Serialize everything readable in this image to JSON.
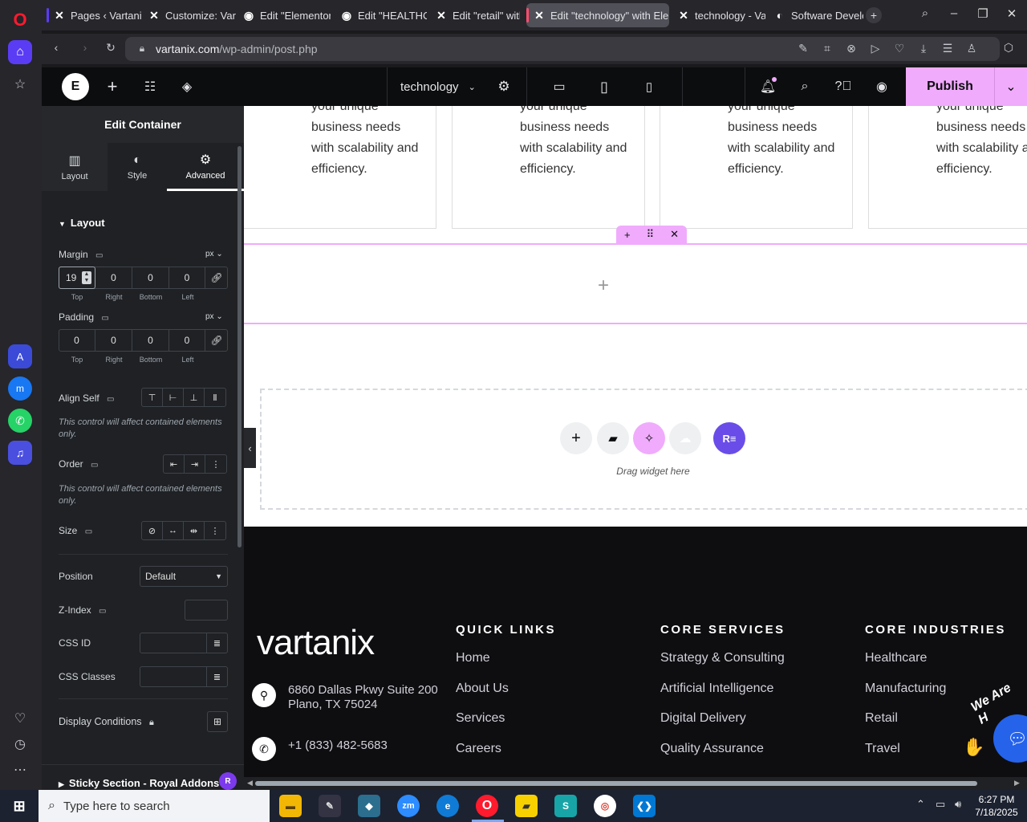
{
  "browser": {
    "tabs": [
      {
        "label": "Pages ‹ Vartanix",
        "icon": "elementor-x"
      },
      {
        "label": "Customize: Vartanix",
        "icon": "elementor-x"
      },
      {
        "label": "Edit \"Elementor",
        "icon": "globe"
      },
      {
        "label": "Edit \"HEALTHCARE",
        "icon": "globe"
      },
      {
        "label": "Edit \"retail\" with",
        "icon": "elementor-x"
      },
      {
        "label": "Edit \"technology\" with Elementor",
        "icon": "elementor-x"
      },
      {
        "label": "technology - Vartanix",
        "icon": "elementor-x"
      },
      {
        "label": "Software Development",
        "icon": "chrome-like"
      }
    ],
    "url_domain": "vartanix.com",
    "url_path": "/wp-admin/post.php"
  },
  "elementor_topbar": {
    "page_name": "technology",
    "publish_label": "Publish"
  },
  "panel": {
    "title": "Edit Container",
    "tabs": [
      {
        "label": "Layout",
        "icon": "layout-icon"
      },
      {
        "label": "Style",
        "icon": "style-icon"
      },
      {
        "label": "Advanced",
        "icon": "gear-icon"
      }
    ],
    "section_layout": "Layout",
    "margin": {
      "label": "Margin",
      "unit": "px",
      "top": "19",
      "right": "0",
      "bottom": "0",
      "left": "0"
    },
    "padding": {
      "label": "Padding",
      "unit": "px",
      "top": "0",
      "right": "0",
      "bottom": "0",
      "left": "0"
    },
    "dim_labels": {
      "top": "Top",
      "right": "Right",
      "bottom": "Bottom",
      "left": "Left"
    },
    "align_self": {
      "label": "Align Self",
      "note": "This control will affect contained elements only."
    },
    "order": {
      "label": "Order",
      "note": "This control will affect contained elements only."
    },
    "size_label": "Size",
    "position": {
      "label": "Position",
      "value": "Default"
    },
    "zindex_label": "Z-Index",
    "css_id_label": "CSS ID",
    "css_classes_label": "CSS Classes",
    "display_conditions_label": "Display Conditions",
    "sticky_section_label": "Sticky Section - Royal Addons",
    "badge": "R"
  },
  "canvas": {
    "card_text": [
      "your unique",
      "business needs",
      "with scalability and",
      "efficiency."
    ],
    "card_text_last": [
      "your unique",
      "business needs",
      "with scalability a",
      "efficiency."
    ],
    "drag_widget_label": "Drag widget here",
    "footer": {
      "logo_text": "vartanix",
      "address_line1": "6860 Dallas Pkwy Suite 200",
      "address_line2": "Plano, TX 75024",
      "phone": "+1 (833) 482-5683",
      "quick_links": {
        "heading": "QUICK LINKS",
        "items": [
          "Home",
          "About Us",
          "Services",
          "Careers"
        ]
      },
      "core_services": {
        "heading": "CORE SERVICES",
        "items": [
          "Strategy & Consulting",
          "Artificial Intelligence",
          "Digital Delivery",
          "Quality Assurance"
        ]
      },
      "core_industries": {
        "heading": "CORE INDUSTRIES",
        "items": [
          "Healthcare",
          "Manufacturing",
          "Retail",
          "Travel"
        ]
      },
      "badge_text": "We Are H"
    }
  },
  "taskbar": {
    "search_placeholder": "Type here to search",
    "time": "6:27 PM",
    "date": "7/18/2025"
  },
  "colors": {
    "accent_pink": "#f0abfc",
    "elementor_dark": "#0c0d0e",
    "panel_bg": "#1f2124",
    "footer_bg": "#0e0e11",
    "brand_blue": "#2563eb"
  }
}
